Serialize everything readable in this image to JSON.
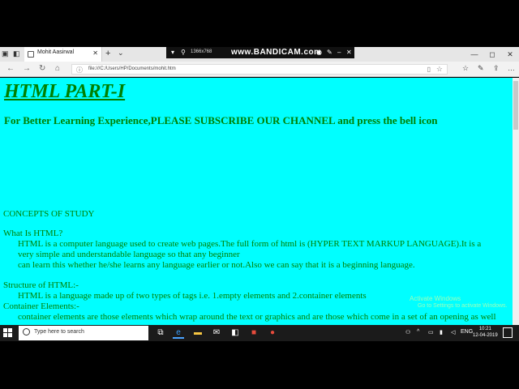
{
  "browser": {
    "tab_title": "Mohit Aasirwal",
    "tab_close": "✕",
    "new_tab": "+",
    "tab_menu": "⌄",
    "url": "file:///C:/Users/HP/Documents/mohit.htm",
    "window_controls": [
      "—",
      "◻",
      "✕"
    ]
  },
  "recorder": {
    "resolution": "1366x768",
    "brand": "www.BANDICAM.com"
  },
  "page": {
    "heading": "HTML PART-I",
    "subheading": "For Better Learning Experience,PLEASE SUBSCRIBE OUR CHANNEL and press the bell icon",
    "concepts_label": "CONCEPTS OF STUDY",
    "q1": "What Is HTML?",
    "a1_line1": "HTML is a computer language used to create web pages.The full form of html is (HYPER TEXT MARKUP LANGUAGE).It is a",
    "a1_line2": "very simple and understandable language so that any beginner",
    "a1_line3": "can learn this whether he/she learns any language earlier or not.Also we can say that it is a beginning language.",
    "q2": "Structure of HTML:-",
    "a2": "HTML is a language made up of two types of tags i.e. 1.empty elements and 2.container elements",
    "q3": "Container Elements:-",
    "a3": "container elements are those elements which wrap around the text or graphics and are those which come in a set of an opening as well",
    "watermark_line1": "Activate Windows",
    "watermark_line2": "Go to Settings to activate Windows."
  },
  "taskbar": {
    "search_placeholder": "Type here to search",
    "language": "ENG",
    "time": "10:21",
    "date": "12-04-2019"
  }
}
